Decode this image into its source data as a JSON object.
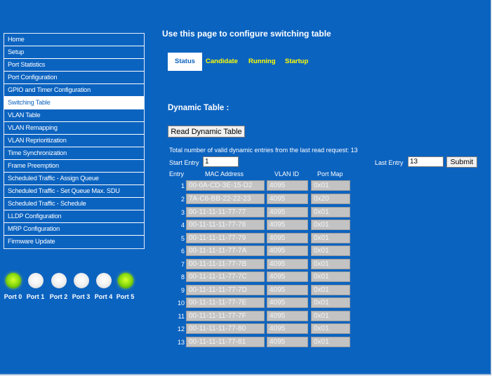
{
  "sidebar": {
    "items": [
      {
        "label": "Home"
      },
      {
        "label": "Setup"
      },
      {
        "label": "Port Statistics"
      },
      {
        "label": "Port Configuration"
      },
      {
        "label": "GPIO and Timer Configuration"
      },
      {
        "label": "Switching Table",
        "active": true
      },
      {
        "label": "VLAN Table"
      },
      {
        "label": "VLAN Remapping"
      },
      {
        "label": "VLAN Reprioritization"
      },
      {
        "label": "Time Synchronization"
      },
      {
        "label": "Frame Preemption"
      },
      {
        "label": "Scheduled Traffic - Assign Queue"
      },
      {
        "label": "Scheduled Traffic - Set Queue Max. SDU"
      },
      {
        "label": "Scheduled Traffic - Schedule"
      },
      {
        "label": "LLDP Configuration"
      },
      {
        "label": "MRP Configuration"
      },
      {
        "label": "Firmware Update"
      }
    ]
  },
  "ports": [
    {
      "label": "Port 0",
      "status": "on"
    },
    {
      "label": "Port 1",
      "status": "off"
    },
    {
      "label": "Port 2",
      "status": "off"
    },
    {
      "label": "Port 3",
      "status": "off"
    },
    {
      "label": "Port 4",
      "status": "off"
    },
    {
      "label": "Port 5",
      "status": "on"
    }
  ],
  "main": {
    "title": "Use this page to configure switching table",
    "tabs": [
      {
        "label": "Status",
        "active": true
      },
      {
        "label": "Candidate"
      },
      {
        "label": "Running"
      },
      {
        "label": "Startup"
      }
    ],
    "section_title": "Dynamic Table :",
    "read_button": "Read Dynamic Table",
    "total_text": "Total number of valid dynamic entries from the last read request: 13",
    "start_entry_label": "Start Entry",
    "start_entry_value": "1",
    "last_entry_label": "Last Entry",
    "last_entry_value": "13",
    "submit_label": "Submit",
    "columns": {
      "entry": "Entry",
      "mac": "MAC Address",
      "vlan": "VLAN ID",
      "portmap": "Port Map"
    },
    "rows": [
      {
        "entry": "1",
        "mac": "00-0A-CD-3E-15-D2",
        "vlan": "4095",
        "portmap": "0x01"
      },
      {
        "entry": "2",
        "mac": "7A-C6-BB-22-22-23",
        "vlan": "4095",
        "portmap": "0x20"
      },
      {
        "entry": "3",
        "mac": "00-11-11-11-77-77",
        "vlan": "4095",
        "portmap": "0x01"
      },
      {
        "entry": "4",
        "mac": "00-11-11-11-77-78",
        "vlan": "4095",
        "portmap": "0x01"
      },
      {
        "entry": "5",
        "mac": "00-11-11-11-77-79",
        "vlan": "4095",
        "portmap": "0x01"
      },
      {
        "entry": "6",
        "mac": "00-11-11-11-77-7A",
        "vlan": "4095",
        "portmap": "0x01"
      },
      {
        "entry": "7",
        "mac": "00-11-11-11-77-7B",
        "vlan": "4095",
        "portmap": "0x01"
      },
      {
        "entry": "8",
        "mac": "00-11-11-11-77-7C",
        "vlan": "4095",
        "portmap": "0x01"
      },
      {
        "entry": "9",
        "mac": "00-11-11-11-77-7D",
        "vlan": "4095",
        "portmap": "0x01"
      },
      {
        "entry": "10",
        "mac": "00-11-11-11-77-7E",
        "vlan": "4095",
        "portmap": "0x01"
      },
      {
        "entry": "11",
        "mac": "00-11-11-11-77-7F",
        "vlan": "4095",
        "portmap": "0x01"
      },
      {
        "entry": "12",
        "mac": "00-11-11-11-77-80",
        "vlan": "4095",
        "portmap": "0x01"
      },
      {
        "entry": "13",
        "mac": "00-11-11-11-77-81",
        "vlan": "4095",
        "portmap": "0x01"
      }
    ]
  },
  "colors": {
    "background": "#0b63c0",
    "tab_text": "#ffff00",
    "led_on": "#8fe010",
    "led_off": "#f2f2f2"
  }
}
